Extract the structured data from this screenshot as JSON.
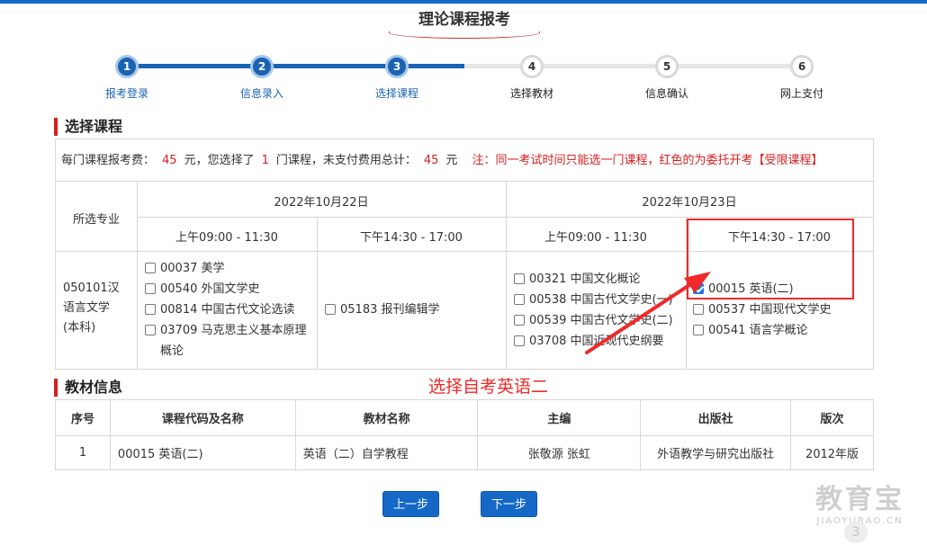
{
  "page": {
    "title": "理论课程报考"
  },
  "steps": [
    {
      "num": "1",
      "label": "报考登录",
      "state": "done"
    },
    {
      "num": "2",
      "label": "信息录入",
      "state": "done"
    },
    {
      "num": "3",
      "label": "选择课程",
      "state": "current"
    },
    {
      "num": "4",
      "label": "选择教材",
      "state": "todo"
    },
    {
      "num": "5",
      "label": "信息确认",
      "state": "todo"
    },
    {
      "num": "6",
      "label": "网上支付",
      "state": "todo"
    }
  ],
  "course_section": {
    "heading": "选择课程",
    "fee": {
      "p1": "每门课程报考费：",
      "fee_value": "45",
      "p2": "元，您选择了",
      "count": "1",
      "p3": "门课程，未支付费用总计：",
      "total": "45",
      "p4": "元",
      "note": "注：同一考试时间只能选一门课程，红色的为委托开考【受限课程】"
    },
    "major_header": "所选专业",
    "dates": [
      "2022年10月22日",
      "2022年10月23日"
    ],
    "sessions": [
      "上午09:00 - 11:30",
      "下午14:30 - 17:00",
      "上午09:00 - 11:30",
      "下午14:30 - 17:00"
    ],
    "major": [
      "050101汉",
      "语言文学",
      "(本科)"
    ],
    "columns": [
      [
        {
          "label": "00037 美学",
          "checked": false
        },
        {
          "label": "00540 外国文学史",
          "checked": false
        },
        {
          "label": "00814 中国古代文论选读",
          "checked": false
        },
        {
          "label": "03709 马克思主义基本原理概论",
          "checked": false
        }
      ],
      [
        {
          "label": "05183 报刊编辑学",
          "checked": false
        }
      ],
      [
        {
          "label": "00321 中国文化概论",
          "checked": false
        },
        {
          "label": "00538 中国古代文学史(一)",
          "checked": false
        },
        {
          "label": "00539 中国古代文学史(二)",
          "checked": false
        },
        {
          "label": "03708 中国近现代史纲要",
          "checked": false
        }
      ],
      [
        {
          "label": "00015 英语(二)",
          "checked": true
        },
        {
          "label": "00537 中国现代文学史",
          "checked": false
        },
        {
          "label": "00541 语言学概论",
          "checked": false
        }
      ]
    ]
  },
  "annotation": {
    "text": "选择自考英语二",
    "color": "#ee2a2a"
  },
  "textbook_section": {
    "heading": "教材信息",
    "headers": [
      "序号",
      "课程代码及名称",
      "教材名称",
      "主编",
      "出版社",
      "版次"
    ],
    "rows": [
      [
        "1",
        "00015 英语(二)",
        "英语（二）自学教程",
        "张敬源 张虹",
        "外语教学与研究出版社",
        "2012年版"
      ]
    ]
  },
  "buttons": {
    "prev": "上一步",
    "next": "下一步"
  },
  "watermark": {
    "main": "教育宝",
    "sub": "JIAOYUBAO.CN",
    "badge": "3"
  },
  "colors": {
    "primary": "#1668c7",
    "accent_red": "#d42020",
    "track_todo": "#e6e6e6"
  }
}
